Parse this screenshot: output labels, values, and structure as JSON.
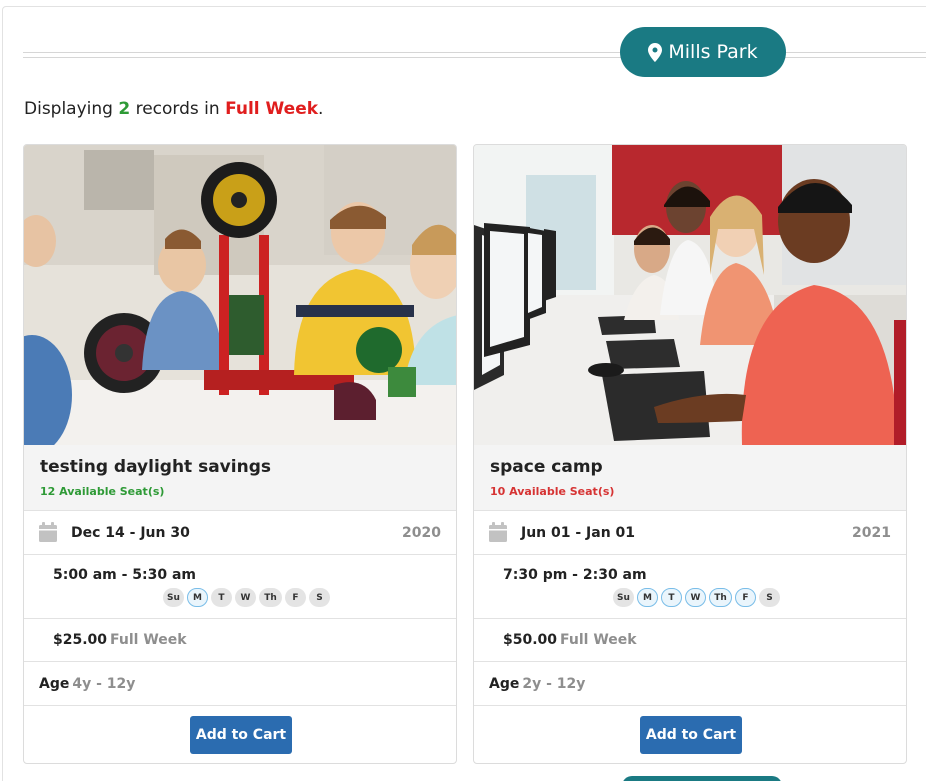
{
  "location": {
    "name": "Mills Park",
    "icon": "map-pin-icon"
  },
  "summary": {
    "prefix": "Displaying",
    "count": "2",
    "middle": "records in",
    "week": "Full Week",
    "suffix": "."
  },
  "colors": {
    "teal": "#1a7a83",
    "green": "#2e9a36",
    "red": "#e01e1e",
    "button_blue": "#2b6cb0"
  },
  "programs": [
    {
      "title": "testing daylight savings",
      "seats": "12 Available Seat(s)",
      "seats_status": "green",
      "date_range": "Dec 14 - Jun 30",
      "year": "2020",
      "time_range": "5:00 am - 5:30 am",
      "days": [
        {
          "label": "Su",
          "active": false
        },
        {
          "label": "M",
          "active": true
        },
        {
          "label": "T",
          "active": false
        },
        {
          "label": "W",
          "active": false
        },
        {
          "label": "Th",
          "active": false
        },
        {
          "label": "F",
          "active": false
        },
        {
          "label": "S",
          "active": false
        }
      ],
      "price": "$25.00",
      "price_unit": "Full Week",
      "age_label": "Age",
      "age_range": "4y - 12y",
      "button": "Add to Cart"
    },
    {
      "title": "space camp",
      "seats": "10 Available Seat(s)",
      "seats_status": "red",
      "date_range": "Jun 01 - Jan 01",
      "year": "2021",
      "time_range": "7:30 pm - 2:30 am",
      "days": [
        {
          "label": "Su",
          "active": false
        },
        {
          "label": "M",
          "active": true
        },
        {
          "label": "T",
          "active": true
        },
        {
          "label": "W",
          "active": true
        },
        {
          "label": "Th",
          "active": true
        },
        {
          "label": "F",
          "active": true
        },
        {
          "label": "S",
          "active": false
        }
      ],
      "price": "$50.00",
      "price_unit": "Full Week",
      "age_label": "Age",
      "age_range": "2y - 12y",
      "button": "Add to Cart"
    }
  ]
}
